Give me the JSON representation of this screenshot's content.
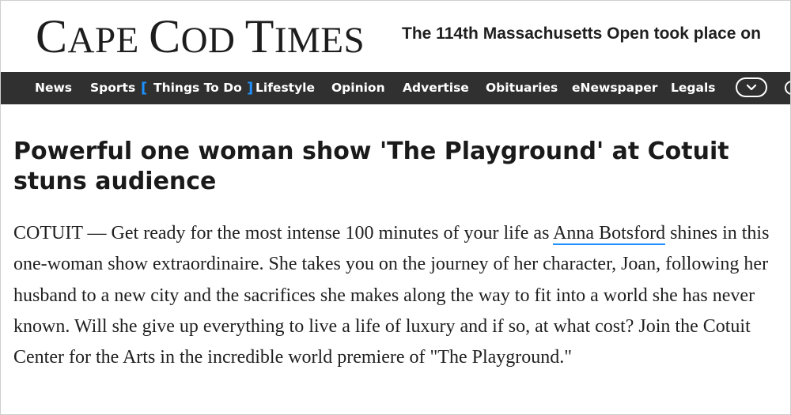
{
  "masthead": {
    "logo_c": "C",
    "logo_ape": "APE ",
    "logo_c2": "C",
    "logo_od": "OD ",
    "logo_t": "T",
    "logo_imes": "IMES",
    "ticker_text": "The 114th Massachusetts Open took place on"
  },
  "nav": {
    "items": [
      {
        "label": "News"
      },
      {
        "label": "Sports"
      },
      {
        "label": "Things To Do"
      },
      {
        "label": "Lifestyle"
      },
      {
        "label": "Opinion"
      },
      {
        "label": "Advertise"
      },
      {
        "label": "Obituaries"
      },
      {
        "label": "eNewspaper"
      },
      {
        "label": "Legals"
      }
    ],
    "bracket_open": "[",
    "bracket_close": "]",
    "more_icon": "chevron-down-icon",
    "search_icon": "search-icon",
    "accent_color": "#1e90ff",
    "background_color": "#303030"
  },
  "article": {
    "title": "Powerful one woman show 'The Playground' at Cotuit stuns audience",
    "body_before_link": "COTUIT — Get ready for the most intense 100 minutes of your life as ",
    "link_text": "Anna Botsford",
    "body_after_link": " shines in this one-woman show extraordinaire. She takes you on the journey of her character, Joan, following her husband to a new city and the sacrifices she makes along the way to fit into a world she has never known.  Will she give up everything to live a life of luxury and if so, at what cost?  Join the Cotuit Center for the Arts in the incredible world premiere of \"The Playground.\""
  }
}
